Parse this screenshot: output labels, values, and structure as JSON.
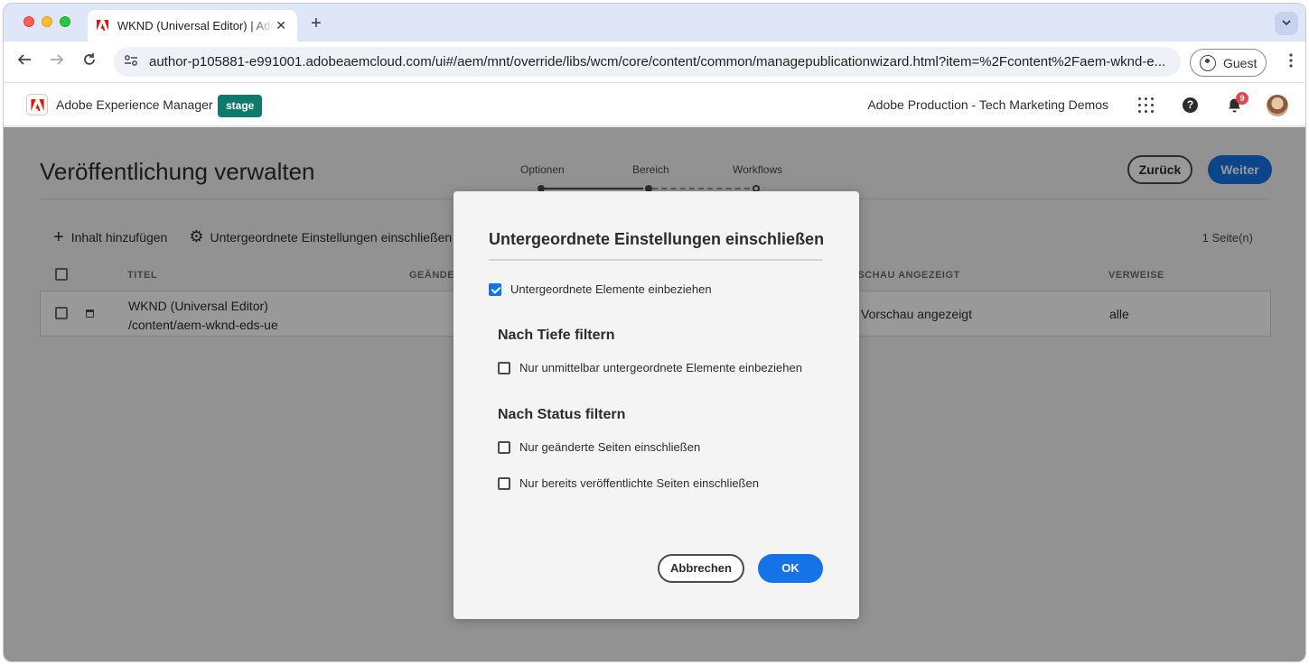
{
  "browser": {
    "tab_title": "WKND (Universal Editor) | Adobe Experience Manager",
    "tab_close_glyph": "✕",
    "new_tab_glyph": "+",
    "url": "author-p105881-e991001.adobeaemcloud.com/ui#/aem/mnt/override/libs/wcm/core/content/common/managepublicationwizard.html?item=%2Fcontent%2Faem-wknd-e...",
    "profile_label": "Guest"
  },
  "aem_header": {
    "product": "Adobe Experience Manager",
    "env_badge": "stage",
    "org": "Adobe Production - Tech Marketing Demos",
    "help_glyph": "?",
    "notification_count": "9"
  },
  "page": {
    "title": "Veröffentlichung verwalten",
    "steps": [
      {
        "label": "Optionen",
        "state": "done"
      },
      {
        "label": "Bereich",
        "state": "current"
      },
      {
        "label": "Workflows",
        "state": "upcoming"
      }
    ],
    "back_label": "Zurück",
    "next_label": "Weiter",
    "actions": {
      "add_content": "Inhalt hinzufügen",
      "include_children": "Untergeordnete Einstellungen einschließen"
    },
    "page_count": "1 Seite(n)",
    "table": {
      "headers": {
        "title": "TITEL",
        "modified": "GEÄNDERT",
        "preview": "VORSCHAU ANGEZEIGT",
        "refs": "VERWEISE"
      },
      "rows": [
        {
          "title": "WKND (Universal Editor)",
          "path": "/content/aem-wknd-eds-ue",
          "preview": "Vorschau angezeigt",
          "refs": "alle"
        }
      ]
    }
  },
  "dialog": {
    "title": "Untergeordnete Einstellungen einschließen",
    "include_children": {
      "label": "Untergeordnete Elemente einbeziehen",
      "checked": true
    },
    "depth_heading": "Nach Tiefe filtern",
    "direct_children": {
      "label": "Nur unmittelbar untergeordnete Elemente einbeziehen",
      "checked": false
    },
    "status_heading": "Nach Status filtern",
    "modified_only": {
      "label": "Nur geänderte Seiten einschließen",
      "checked": false
    },
    "published_only": {
      "label": "Nur bereits veröffentlichte Seiten einschließen",
      "checked": false
    },
    "cancel_label": "Abbrechen",
    "ok_label": "OK"
  },
  "colors": {
    "accent": "#1473e6",
    "stage_badge": "#0d7a6c",
    "notification_badge": "#e34850",
    "adobe_red": "#eb1000"
  }
}
